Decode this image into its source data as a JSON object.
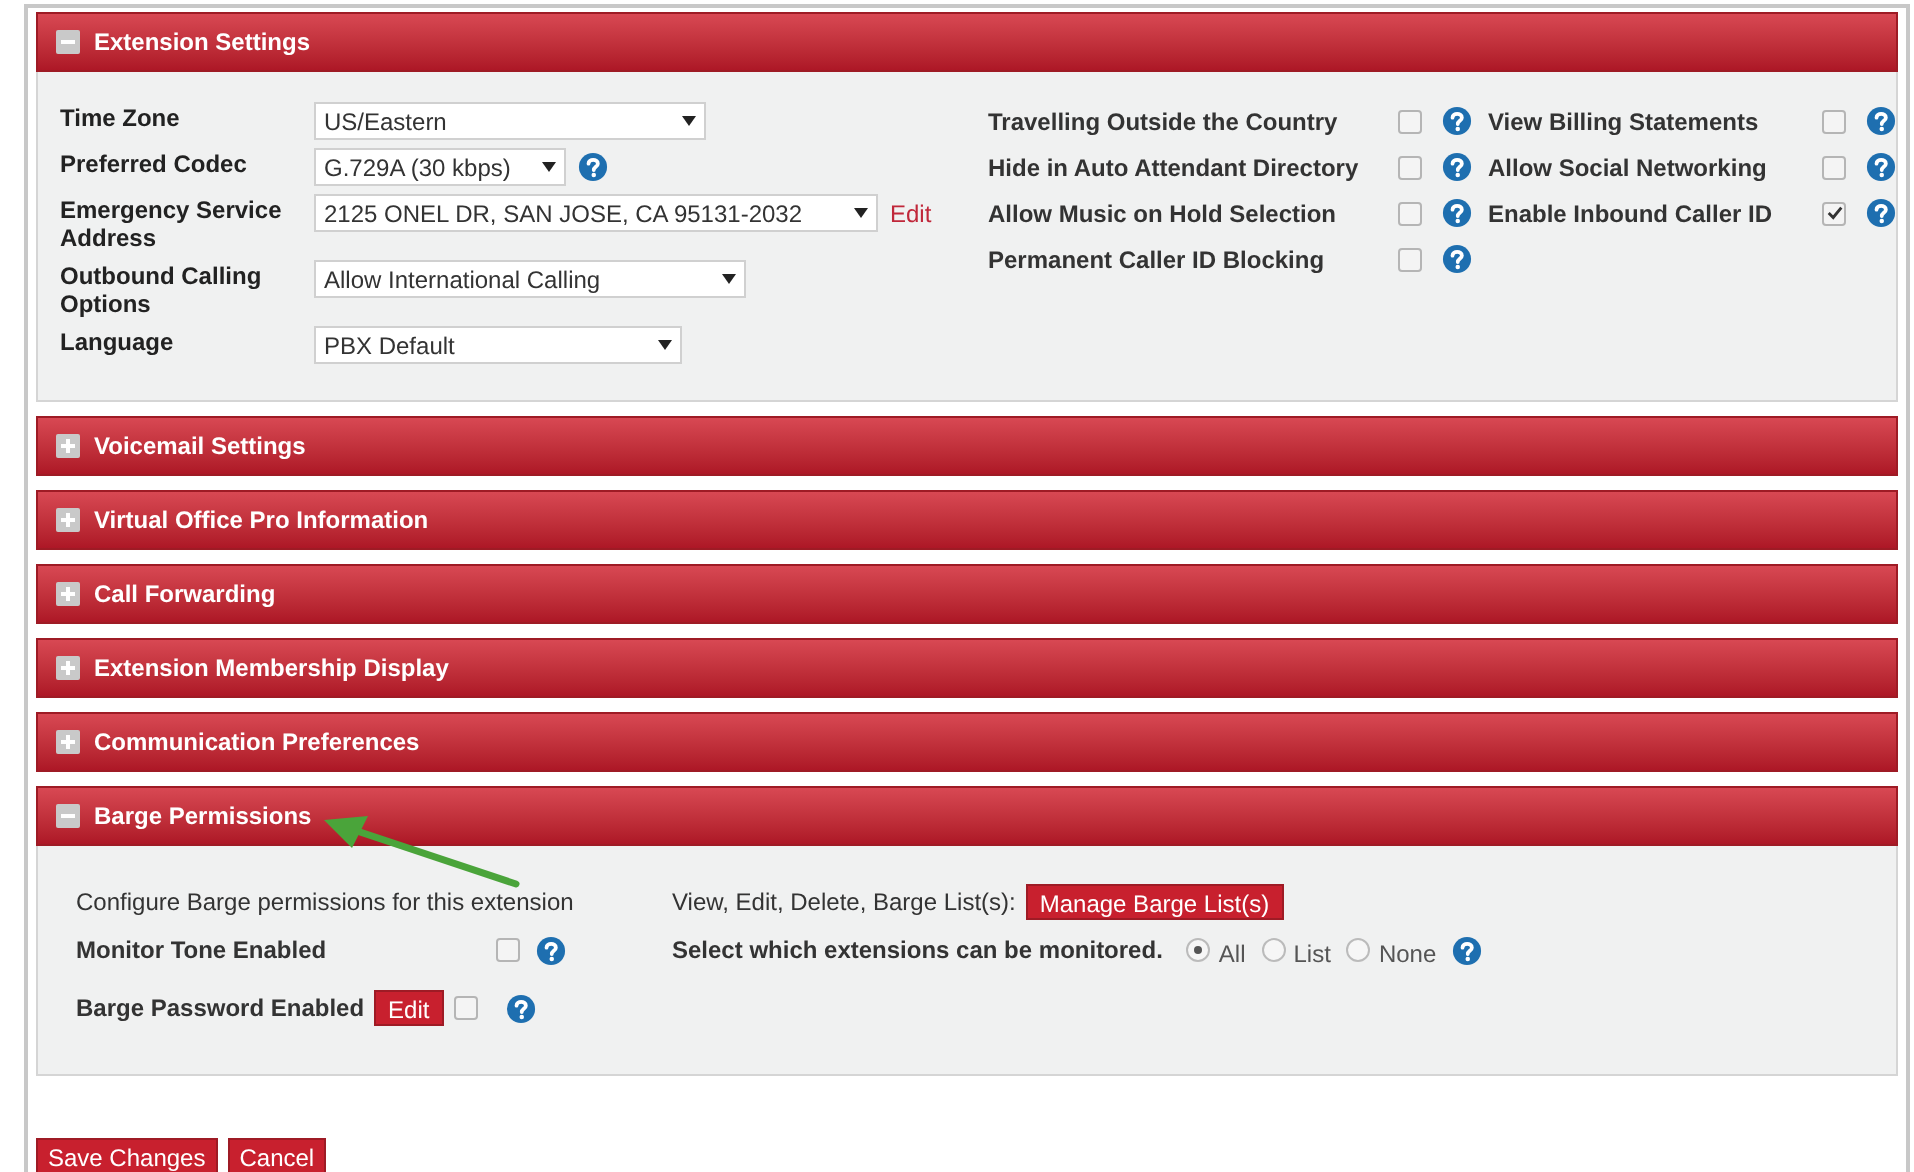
{
  "sections": [
    {
      "kind": "extension",
      "title": "Extension Settings",
      "expanded": true,
      "fields": [
        {
          "label": "Time Zone",
          "value": "US/Eastern",
          "help": false
        },
        {
          "label": "Preferred Codec",
          "value": "G.729A (30 kbps)",
          "help": true
        },
        {
          "label": "Emergency Service Address",
          "value": "2125 ONEL DR, SAN JOSE, CA 95131-2032",
          "help": false,
          "link": "Edit"
        },
        {
          "label": "Outbound Calling Options",
          "value": "Allow International Calling",
          "help": false
        },
        {
          "label": "Language",
          "value": "PBX Default",
          "help": false
        }
      ],
      "option_columns": [
        [
          {
            "label": "Travelling Outside the Country",
            "checked": false
          },
          {
            "label": "Hide in Auto Attendant Directory",
            "checked": false
          },
          {
            "label": "Allow Music on Hold Selection",
            "checked": false
          },
          {
            "label": "Permanent Caller ID Blocking",
            "checked": false
          }
        ],
        [
          {
            "label": "View Billing Statements",
            "checked": false
          },
          {
            "label": "Allow Social Networking",
            "checked": false
          },
          {
            "label": "Enable Inbound Caller ID",
            "checked": true
          }
        ]
      ]
    },
    {
      "title": "Voicemail Settings",
      "expanded": false
    },
    {
      "title": "Virtual Office Pro Information",
      "expanded": false
    },
    {
      "title": "Call Forwarding",
      "expanded": false
    },
    {
      "title": "Extension Membership Display",
      "expanded": false
    },
    {
      "title": "Communication Preferences",
      "expanded": false
    },
    {
      "kind": "barge",
      "title": "Barge Permissions",
      "expanded": true,
      "configure_text": "Configure Barge permissions for this extension",
      "list_label": "View, Edit, Delete, Barge List(s):",
      "list_button": "Manage Barge List(s)",
      "monitor_tone": {
        "label": "Monitor Tone Enabled",
        "checked": false
      },
      "monitor_label": "Select which extensions can be monitored.",
      "monitor_options": [
        {
          "label": "All",
          "selected": true
        },
        {
          "label": "List",
          "selected": false
        },
        {
          "label": "None",
          "selected": false
        }
      ],
      "password": {
        "label": "Barge Password Enabled",
        "button": "Edit",
        "checked": false
      }
    }
  ],
  "buttons": [
    "Save Changes",
    "Cancel"
  ]
}
